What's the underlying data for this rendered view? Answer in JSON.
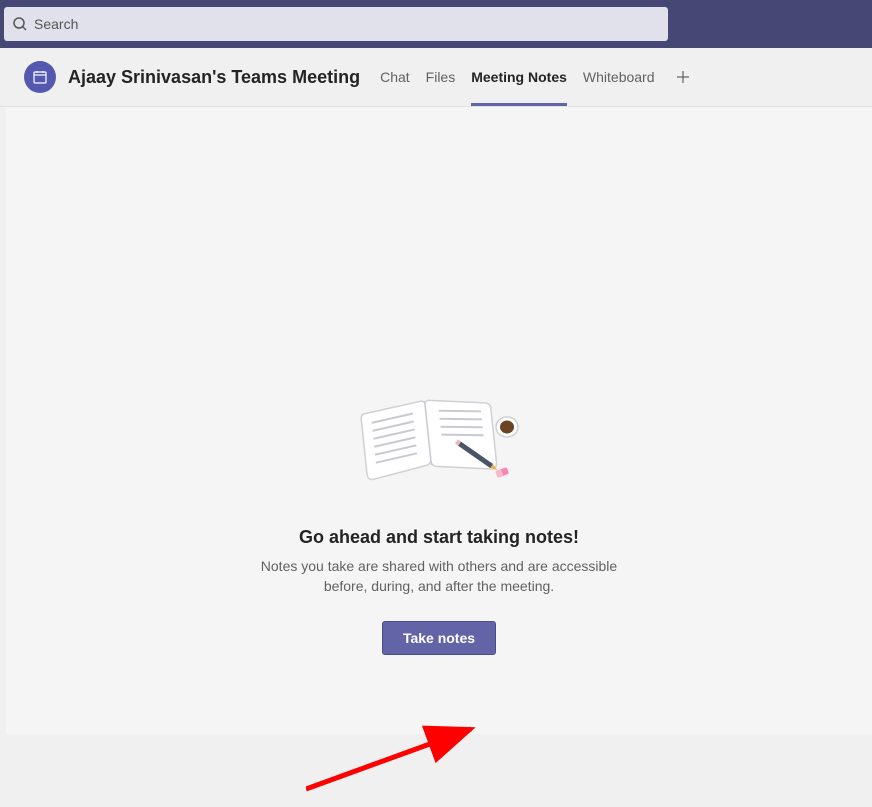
{
  "search": {
    "placeholder": "Search"
  },
  "header": {
    "title": "Ajaay Srinivasan's Teams Meeting",
    "tabs": [
      {
        "label": "Chat"
      },
      {
        "label": "Files"
      },
      {
        "label": "Meeting Notes"
      },
      {
        "label": "Whiteboard"
      }
    ],
    "active_tab": "Meeting Notes"
  },
  "empty_state": {
    "title": "Go ahead and start taking notes!",
    "description": "Notes you take are shared with others and are accessible before, during, and after the meeting.",
    "button_label": "Take notes"
  }
}
